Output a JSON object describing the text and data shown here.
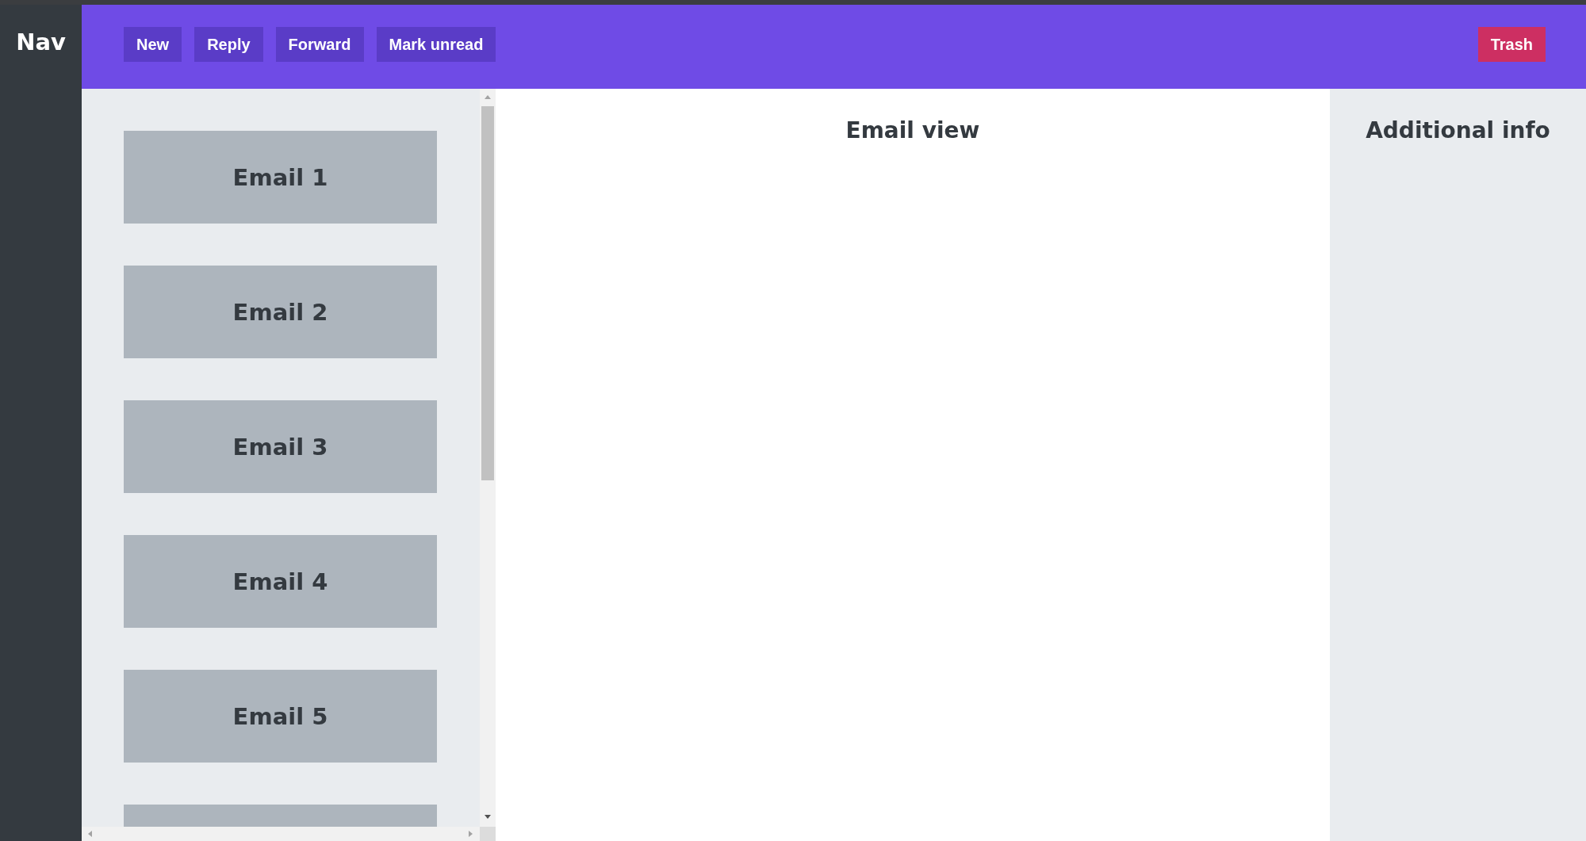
{
  "nav": {
    "title": "Nav"
  },
  "toolbar": {
    "buttons": [
      {
        "label": "New",
        "kind": "action"
      },
      {
        "label": "Reply",
        "kind": "action"
      },
      {
        "label": "Forward",
        "kind": "action"
      },
      {
        "label": "Mark unread",
        "kind": "action"
      },
      {
        "label": "Trash",
        "kind": "danger"
      }
    ]
  },
  "email_list": {
    "items": [
      {
        "label": "Email 1"
      },
      {
        "label": "Email 2"
      },
      {
        "label": "Email 3"
      },
      {
        "label": "Email 4"
      },
      {
        "label": "Email 5",
        "kind": "email"
      },
      {
        "kind": "partial"
      }
    ]
  },
  "email_view": {
    "title": "Email view"
  },
  "info_panel": {
    "title": "Additional info"
  }
}
